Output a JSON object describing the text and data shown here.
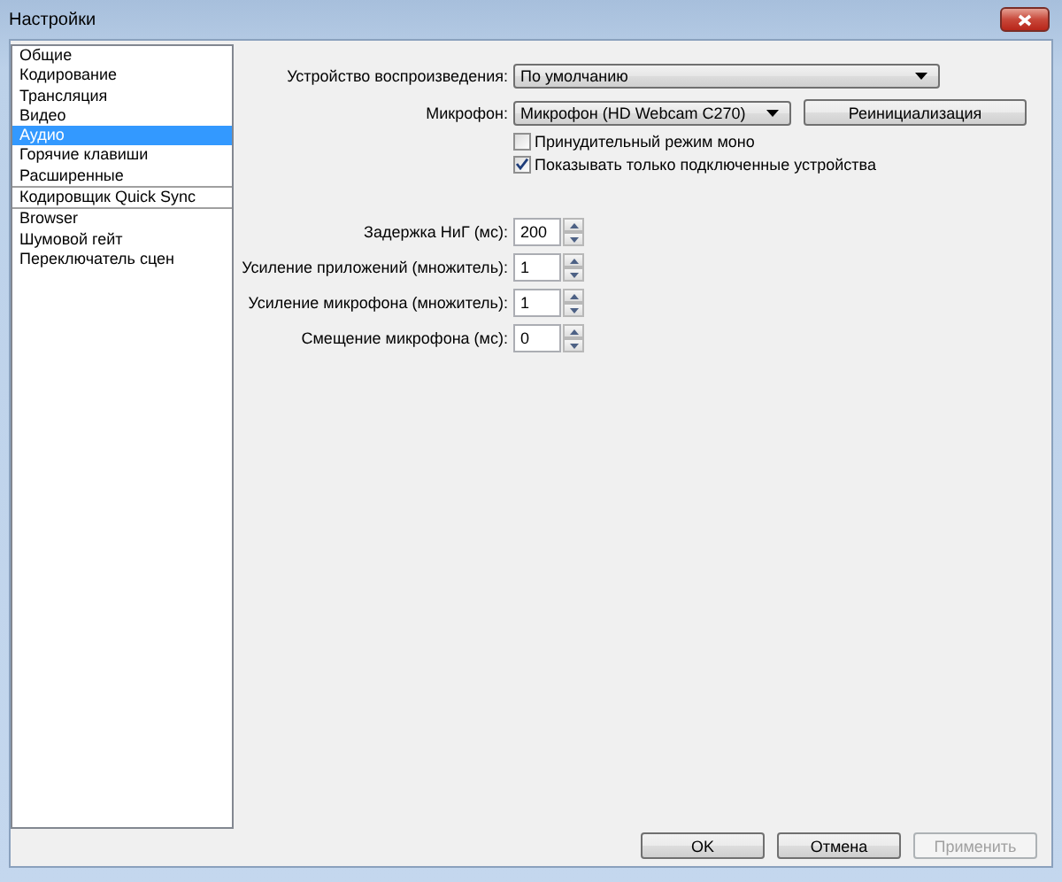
{
  "window": {
    "title": "Настройки"
  },
  "sidebar": {
    "groups": [
      {
        "items": [
          {
            "label": "Общие",
            "selected": false
          },
          {
            "label": "Кодирование",
            "selected": false
          },
          {
            "label": "Трансляция",
            "selected": false
          },
          {
            "label": "Видео",
            "selected": false
          },
          {
            "label": "Аудио",
            "selected": true
          },
          {
            "label": "Горячие клавиши",
            "selected": false
          },
          {
            "label": "Расширенные",
            "selected": false
          }
        ]
      },
      {
        "items": [
          {
            "label": "Кодировщик Quick Sync",
            "selected": false
          }
        ]
      },
      {
        "items": [
          {
            "label": "Browser",
            "selected": false
          },
          {
            "label": "Шумовой гейт",
            "selected": false
          },
          {
            "label": "Переключатель сцен",
            "selected": false
          }
        ]
      }
    ]
  },
  "audio": {
    "playback_device": {
      "label": "Устройство воспроизведения:",
      "value": "По умолчанию"
    },
    "microphone": {
      "label": "Микрофон:",
      "value": "Микрофон (HD Webcam C270)"
    },
    "reinit_button": "Реинициализация",
    "checkboxes": [
      {
        "label": "Принудительный режим моно",
        "checked": false
      },
      {
        "label": "Показывать только подключенные устройства",
        "checked": true
      }
    ],
    "spinboxes": [
      {
        "label": "Задержка НиГ (мс):",
        "value": "200"
      },
      {
        "label": "Усиление приложений (множитель):",
        "value": "1"
      },
      {
        "label": "Усиление микрофона (множитель):",
        "value": "1"
      },
      {
        "label": "Смещение микрофона (мс):",
        "value": "0"
      }
    ]
  },
  "buttons": [
    {
      "label": "OK",
      "disabled": false
    },
    {
      "label": "Отмена",
      "disabled": false
    },
    {
      "label": "Применить",
      "disabled": true
    }
  ]
}
